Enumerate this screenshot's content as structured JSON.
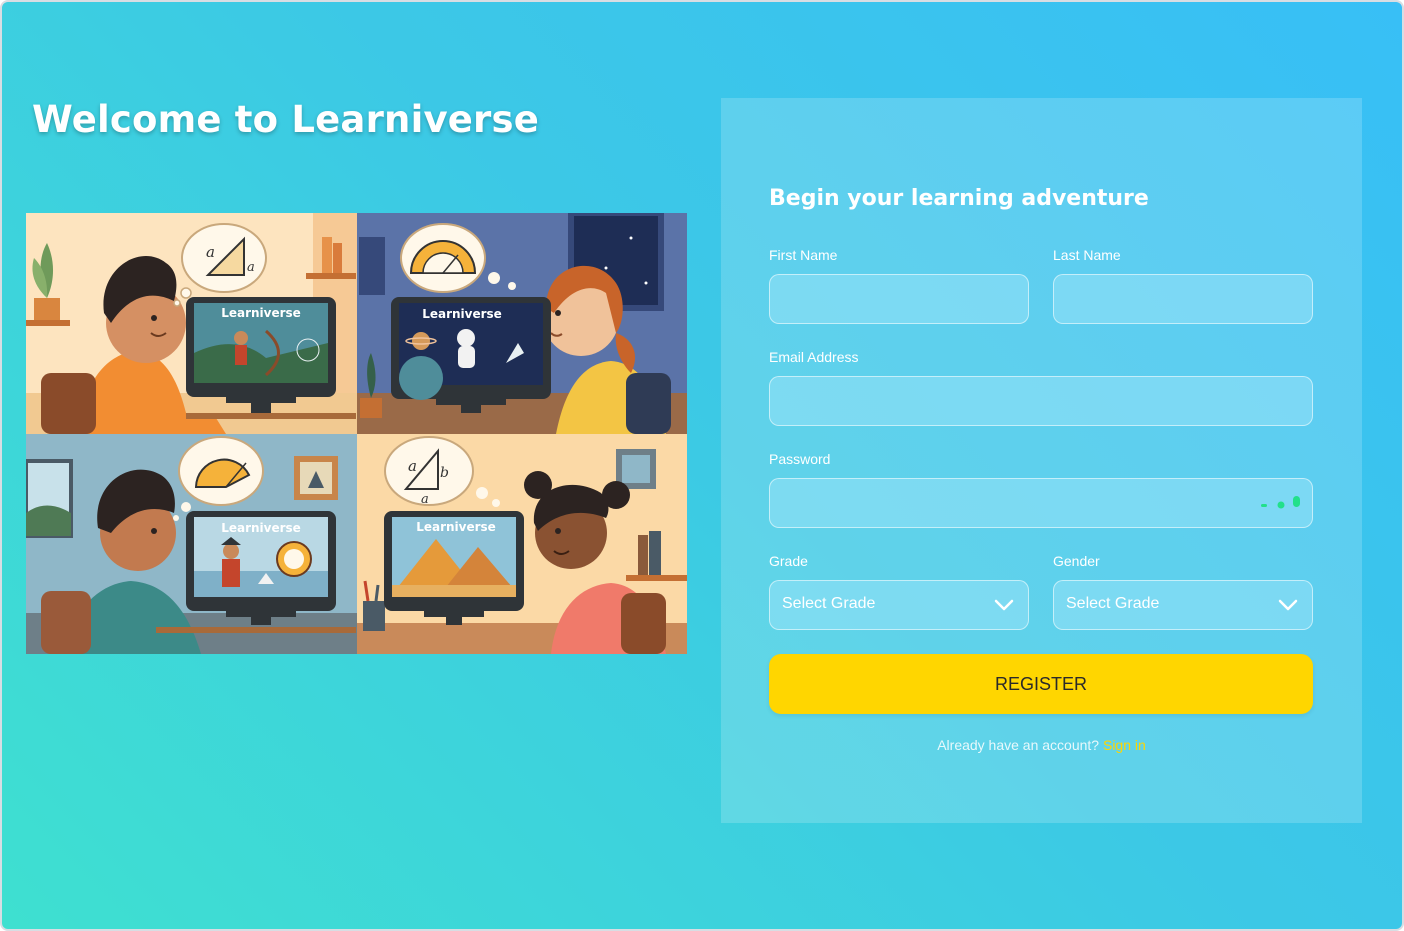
{
  "page": {
    "welcome_title": "Welcome to Learniverse"
  },
  "hero": {
    "screen_brand": "Learniverse",
    "math_labels": {
      "a": "a",
      "b": "b"
    }
  },
  "form": {
    "title": "Begin your learning adventure",
    "first_name": {
      "label": "First Name",
      "value": "",
      "placeholder": ""
    },
    "last_name": {
      "label": "Last Name",
      "value": "",
      "placeholder": ""
    },
    "email": {
      "label": "Email Address",
      "value": "",
      "placeholder": ""
    },
    "password": {
      "label": "Password",
      "value": "",
      "placeholder": ""
    },
    "grade": {
      "label": "Grade",
      "selected": "Select Grade"
    },
    "gender": {
      "label": "Gender",
      "selected": "Select Grade"
    },
    "register_label": "REGISTER",
    "signin_prompt": "Already have an account?",
    "signin_link": "Sign in"
  },
  "colors": {
    "gradient_start": "#3ee0d0",
    "gradient_end": "#38bff6",
    "accent_button": "#ffd600",
    "strength_indicator": "#22e08a",
    "link": "#ffd600"
  },
  "icons": {
    "select_chevron": "chevron-down-icon",
    "password_strength": "password-strength-icon"
  }
}
